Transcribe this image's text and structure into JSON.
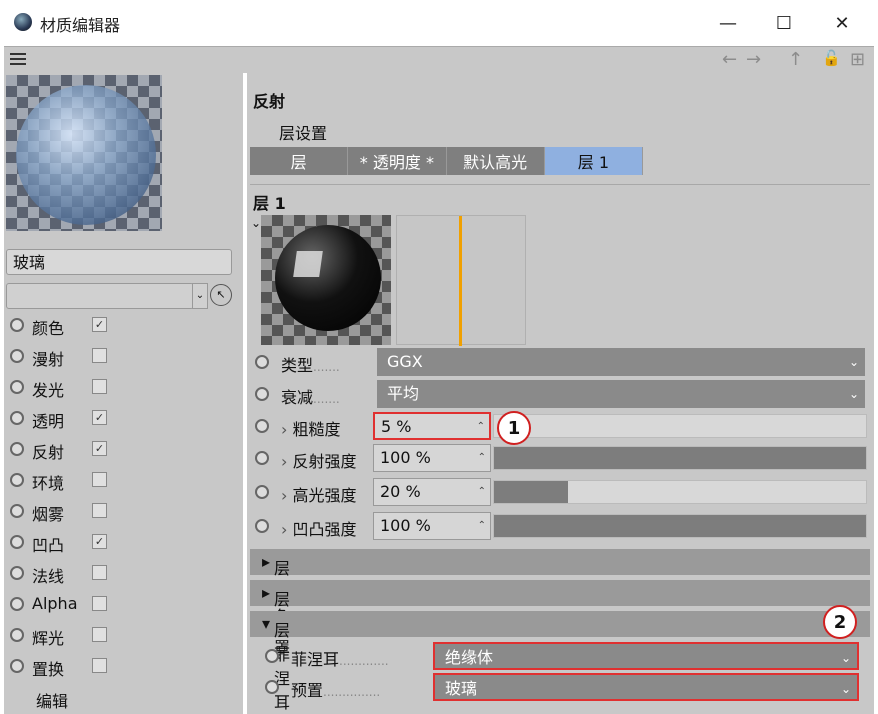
{
  "window": {
    "title": "材质编辑器",
    "minimize": "—",
    "maximize": "☐",
    "close": "✕"
  },
  "nav": {
    "back": "←",
    "forward": "→",
    "up": "↑",
    "lock": "🔓",
    "new": "⊞"
  },
  "left": {
    "material_name": "玻璃",
    "channels": [
      {
        "label": "颜色",
        "checked": true
      },
      {
        "label": "漫射",
        "checked": false
      },
      {
        "label": "发光",
        "checked": false
      },
      {
        "label": "透明",
        "checked": true
      },
      {
        "label": "反射",
        "checked": true
      },
      {
        "label": "环境",
        "checked": false
      },
      {
        "label": "烟雾",
        "checked": false
      },
      {
        "label": "凹凸",
        "checked": true
      },
      {
        "label": "法线",
        "checked": false
      },
      {
        "label": "Alpha",
        "checked": false
      },
      {
        "label": "辉光",
        "checked": false
      },
      {
        "label": "置换",
        "checked": false
      }
    ],
    "edit_label": "编辑"
  },
  "right": {
    "section_title": "反射",
    "layer_settings_label": "层设置",
    "tabs": [
      "层",
      "* 透明度 *",
      "默认高光",
      "层 1"
    ],
    "active_tab": 3,
    "layer_title": "层 1",
    "type": {
      "label": "类型",
      "value": "GGX"
    },
    "attenuation": {
      "label": "衰减",
      "value": "平均"
    },
    "params": [
      {
        "label": "粗糙度",
        "value": "5 %",
        "level": 0.0
      },
      {
        "label": "反射强度",
        "value": "100 %",
        "level": 1.0
      },
      {
        "label": "高光强度",
        "value": "20 %",
        "level": 0.2
      },
      {
        "label": "凹凸强度",
        "value": "100 %",
        "level": 1.0
      }
    ],
    "sections": [
      "层颜色",
      "层遮罩",
      "层菲涅耳"
    ],
    "fresnel": {
      "label": "菲涅耳",
      "value": "绝缘体"
    },
    "preset": {
      "label": "预置",
      "value": "玻璃"
    },
    "annotations": [
      "1",
      "2"
    ]
  }
}
